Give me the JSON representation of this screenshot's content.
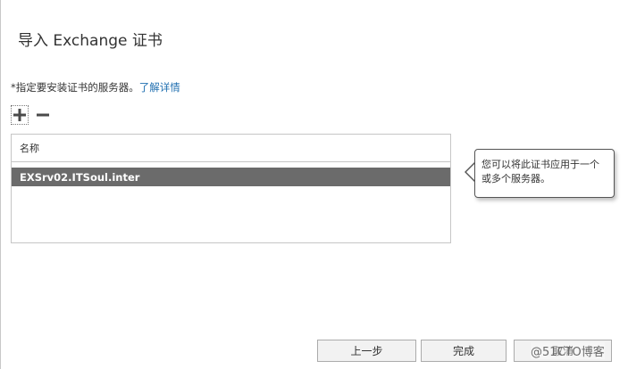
{
  "dialog": {
    "title": "导入 Exchange 证书"
  },
  "instruction": {
    "text": "*指定要安装证书的服务器。",
    "link": "了解详情"
  },
  "toolbar": {
    "add_icon": "plus-icon",
    "remove_icon": "minus-icon"
  },
  "server_list": {
    "header": "名称",
    "rows": [
      "EXSrv02.ITSoul.inter"
    ]
  },
  "callout": {
    "text": "您可以将此证书应用于一个或多个服务器。"
  },
  "buttons": {
    "back": "上一步",
    "finish": "完成",
    "cancel": "取消"
  },
  "watermark": "@51CTO博客",
  "colors": {
    "selection": "#6b6b6b",
    "link": "#1f6fb0"
  }
}
